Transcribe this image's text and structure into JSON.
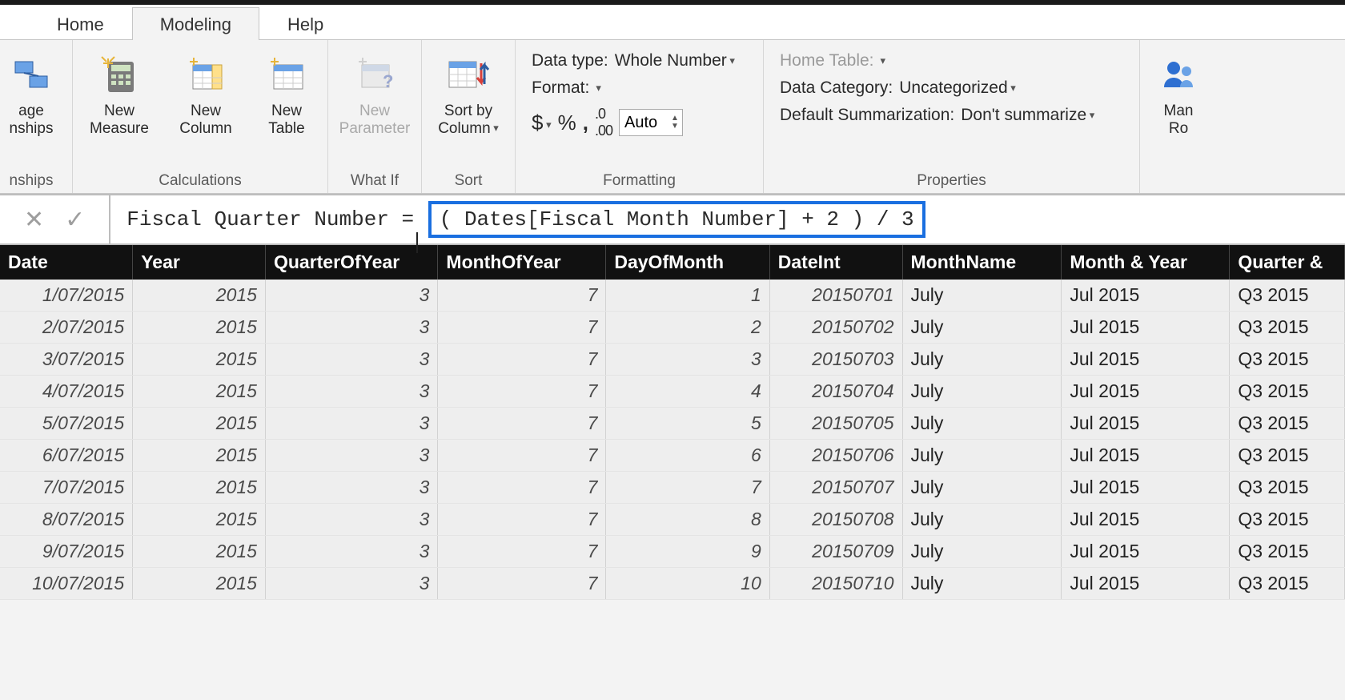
{
  "tabs": {
    "home": "Home",
    "modeling": "Modeling",
    "help": "Help",
    "active": "modeling"
  },
  "ribbon": {
    "relationships": {
      "label": "nships",
      "btn1_l1": "age",
      "btn1_l2": "nships"
    },
    "calculations": {
      "label": "Calculations",
      "new_measure_l1": "New",
      "new_measure_l2": "Measure",
      "new_column_l1": "New",
      "new_column_l2": "Column",
      "new_table_l1": "New",
      "new_table_l2": "Table"
    },
    "whatif": {
      "label": "What If",
      "new_param_l1": "New",
      "new_param_l2": "Parameter"
    },
    "sort": {
      "label": "Sort",
      "sort_by_l1": "Sort by",
      "sort_by_l2": "Column"
    },
    "formatting": {
      "label": "Formatting",
      "data_type_label": "Data type:",
      "data_type_value": "Whole Number",
      "format_label": "Format:",
      "currency_symbol": "$",
      "percent_symbol": "%",
      "thousands_symbol": ",",
      "decimals_icon": ".00",
      "decimals_value": "Auto"
    },
    "properties": {
      "label": "Properties",
      "home_table_label": "Home Table:",
      "data_category_label": "Data Category:",
      "data_category_value": "Uncategorized",
      "default_sum_label": "Default Summarization:",
      "default_sum_value": "Don't summarize"
    },
    "right_cut": {
      "l1": "Man",
      "l2": "Ro"
    }
  },
  "formula": {
    "prefix": "Fiscal Quarter Number = ",
    "highlight": "( Dates[Fiscal Month Number] + 2 ) / 3"
  },
  "grid": {
    "headers": [
      "Date",
      "Year",
      "QuarterOfYear",
      "MonthOfYear",
      "DayOfMonth",
      "DateInt",
      "MonthName",
      "Month & Year",
      "Quarter & "
    ],
    "rows": [
      {
        "date": "1/07/2015",
        "year": "2015",
        "qoy": "3",
        "moy": "7",
        "dom": "1",
        "dint": "20150701",
        "mname": "July",
        "myear": "Jul 2015",
        "qyear": "Q3 2015"
      },
      {
        "date": "2/07/2015",
        "year": "2015",
        "qoy": "3",
        "moy": "7",
        "dom": "2",
        "dint": "20150702",
        "mname": "July",
        "myear": "Jul 2015",
        "qyear": "Q3 2015"
      },
      {
        "date": "3/07/2015",
        "year": "2015",
        "qoy": "3",
        "moy": "7",
        "dom": "3",
        "dint": "20150703",
        "mname": "July",
        "myear": "Jul 2015",
        "qyear": "Q3 2015"
      },
      {
        "date": "4/07/2015",
        "year": "2015",
        "qoy": "3",
        "moy": "7",
        "dom": "4",
        "dint": "20150704",
        "mname": "July",
        "myear": "Jul 2015",
        "qyear": "Q3 2015"
      },
      {
        "date": "5/07/2015",
        "year": "2015",
        "qoy": "3",
        "moy": "7",
        "dom": "5",
        "dint": "20150705",
        "mname": "July",
        "myear": "Jul 2015",
        "qyear": "Q3 2015"
      },
      {
        "date": "6/07/2015",
        "year": "2015",
        "qoy": "3",
        "moy": "7",
        "dom": "6",
        "dint": "20150706",
        "mname": "July",
        "myear": "Jul 2015",
        "qyear": "Q3 2015"
      },
      {
        "date": "7/07/2015",
        "year": "2015",
        "qoy": "3",
        "moy": "7",
        "dom": "7",
        "dint": "20150707",
        "mname": "July",
        "myear": "Jul 2015",
        "qyear": "Q3 2015"
      },
      {
        "date": "8/07/2015",
        "year": "2015",
        "qoy": "3",
        "moy": "7",
        "dom": "8",
        "dint": "20150708",
        "mname": "July",
        "myear": "Jul 2015",
        "qyear": "Q3 2015"
      },
      {
        "date": "9/07/2015",
        "year": "2015",
        "qoy": "3",
        "moy": "7",
        "dom": "9",
        "dint": "20150709",
        "mname": "July",
        "myear": "Jul 2015",
        "qyear": "Q3 2015"
      },
      {
        "date": "10/07/2015",
        "year": "2015",
        "qoy": "3",
        "moy": "7",
        "dom": "10",
        "dint": "20150710",
        "mname": "July",
        "myear": "Jul 2015",
        "qyear": "Q3 2015"
      }
    ]
  }
}
